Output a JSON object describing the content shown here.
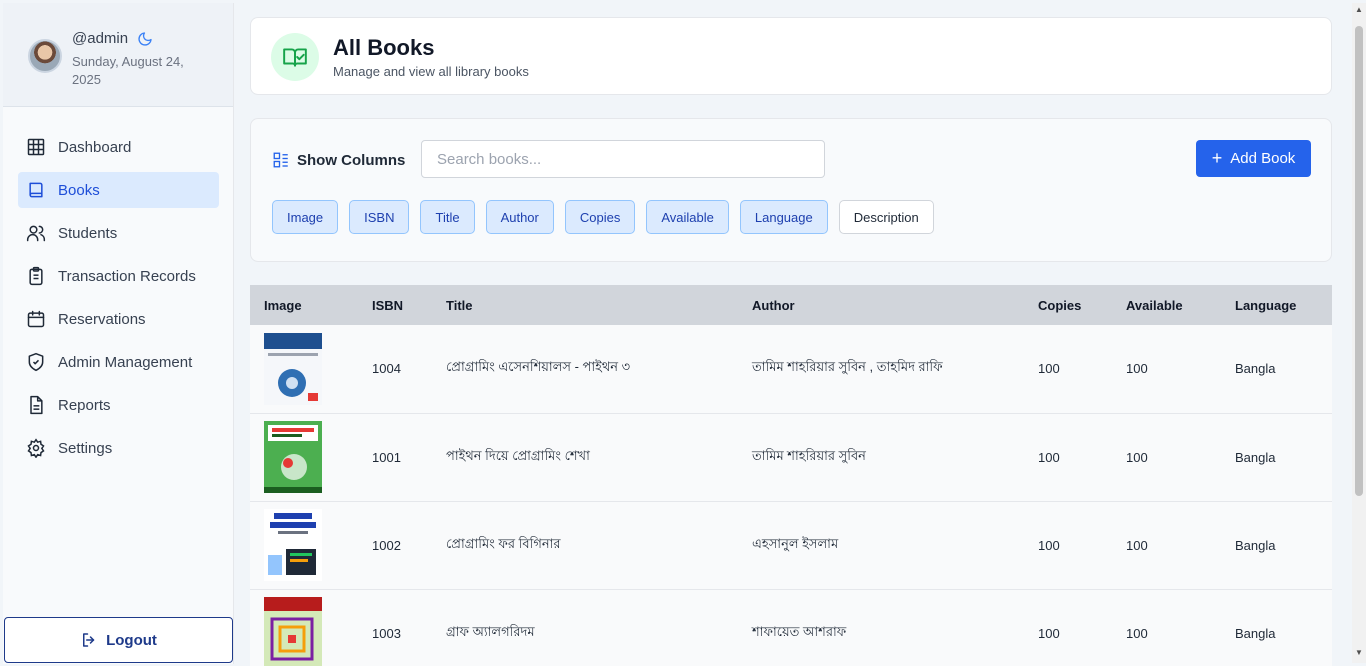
{
  "profile": {
    "username": "@admin",
    "date": "Sunday, August 24, 2025"
  },
  "nav": [
    {
      "label": "Dashboard",
      "icon": "grid-icon"
    },
    {
      "label": "Books",
      "icon": "book-icon",
      "active": true
    },
    {
      "label": "Students",
      "icon": "users-icon"
    },
    {
      "label": "Transaction Records",
      "icon": "clipboard-icon"
    },
    {
      "label": "Reservations",
      "icon": "calendar-icon"
    },
    {
      "label": "Admin Management",
      "icon": "shield-icon"
    },
    {
      "label": "Reports",
      "icon": "file-text-icon"
    },
    {
      "label": "Settings",
      "icon": "gear-icon"
    }
  ],
  "logout_label": "Logout",
  "header": {
    "title": "All Books",
    "subtitle": "Manage and view all library books"
  },
  "controls": {
    "show_columns": "Show Columns",
    "search_placeholder": "Search books...",
    "add_book": "Add Book",
    "columns": [
      {
        "label": "Image",
        "on": true
      },
      {
        "label": "ISBN",
        "on": true
      },
      {
        "label": "Title",
        "on": true
      },
      {
        "label": "Author",
        "on": true
      },
      {
        "label": "Copies",
        "on": true
      },
      {
        "label": "Available",
        "on": true
      },
      {
        "label": "Language",
        "on": true
      },
      {
        "label": "Description",
        "on": false
      }
    ]
  },
  "table": {
    "headers": [
      "Image",
      "ISBN",
      "Title",
      "Author",
      "Copies",
      "Available",
      "Language"
    ],
    "rows": [
      {
        "isbn": "1004",
        "title": "প্রোগ্রামিং এসেনশিয়ালস - পাইথন ৩",
        "author": "তামিম শাহরিয়ার সুবিন , তাহমিদ রাফি",
        "copies": "100",
        "available": "100",
        "language": "Bangla",
        "cover": "#1e4f8f"
      },
      {
        "isbn": "1001",
        "title": "পাইথন দিয়ে প্রোগ্রামিং শেখা",
        "author": "তামিম শাহরিয়ার সুবিন",
        "copies": "100",
        "available": "100",
        "language": "Bangla",
        "cover": "#4caf50"
      },
      {
        "isbn": "1002",
        "title": "প্রোগ্রামিং ফর বিগিনার",
        "author": "এহসানুল ইসলাম",
        "copies": "100",
        "available": "100",
        "language": "Bangla",
        "cover": "#e8eef7"
      },
      {
        "isbn": "1003",
        "title": "গ্রাফ অ্যালগরিদম",
        "author": "শাফায়েত আশরাফ",
        "copies": "100",
        "available": "100",
        "language": "Bangla",
        "cover": "#8bc34a"
      }
    ]
  }
}
